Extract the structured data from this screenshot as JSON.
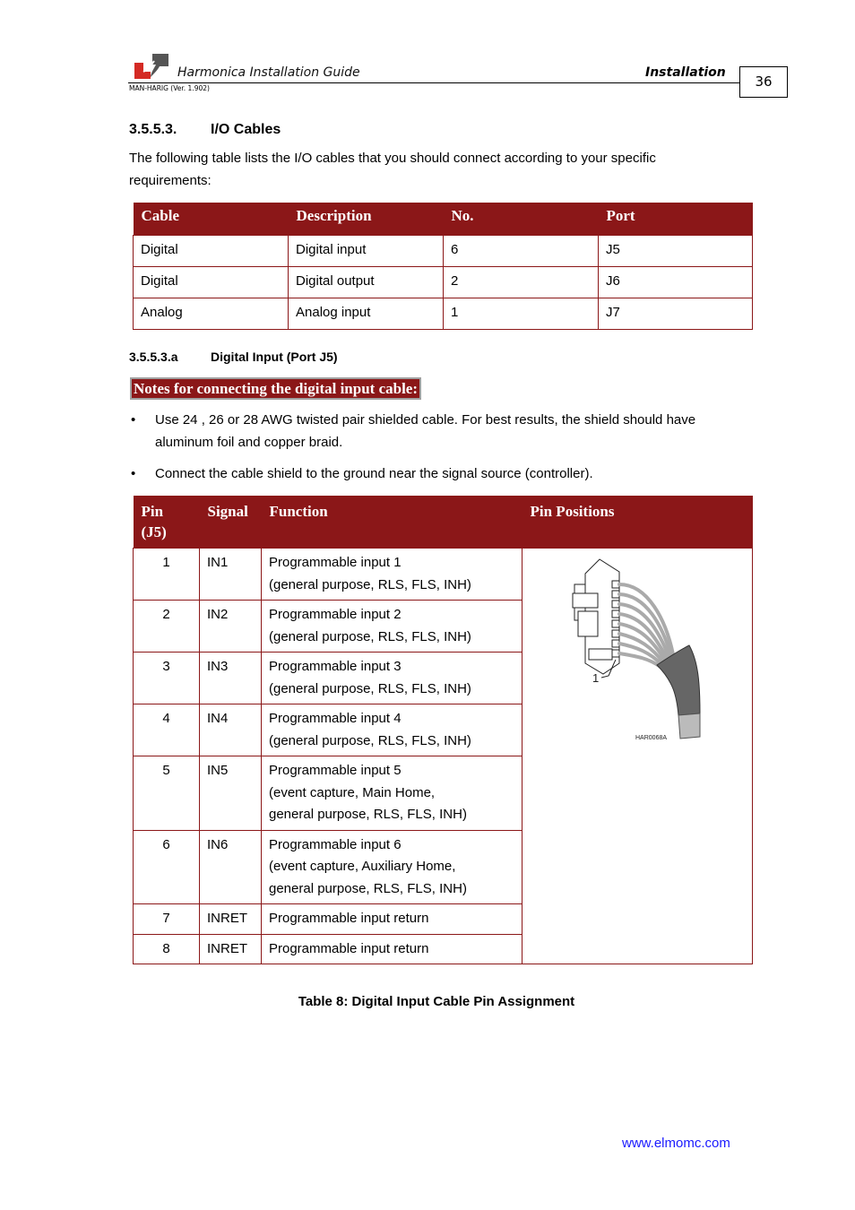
{
  "header": {
    "doc_title": "Harmonica Installation Guide",
    "section": "Installation",
    "version": "MAN-HARIG (Ver. 1.902)",
    "page_number": "36",
    "logo": "elmo-logo-icon"
  },
  "section_io": {
    "number": "3.5.5.3.",
    "title": "I/O Cables",
    "intro": "The following table lists the I/O cables that you should connect according to your specific requirements:"
  },
  "cable_table": {
    "headers": [
      "Cable",
      "Description",
      "No.",
      "Port"
    ],
    "rows": [
      [
        "Digital",
        "Digital input",
        "6",
        "J5"
      ],
      [
        "Digital",
        "Digital output",
        "2",
        "J6"
      ],
      [
        "Analog",
        "Analog input",
        "1",
        "J7"
      ]
    ]
  },
  "section_digital": {
    "number": "3.5.5.3.a",
    "title": "Digital Input (Port J5)",
    "notes_heading": "Notes for connecting the digital input cable:",
    "bullets": [
      "Use 24 , 26 or 28 AWG twisted pair shielded cable. For best results, the shield should have aluminum foil and copper braid.",
      "Connect the cable shield to the ground near the signal source (controller)."
    ],
    "bullet_char": "•"
  },
  "pin_table": {
    "headers": [
      "Pin (J5)",
      "Signal",
      "Function",
      "Pin Positions"
    ],
    "rows": [
      {
        "pin": "1",
        "signal": "IN1",
        "function": [
          "Programmable input 1",
          "(general purpose, RLS, FLS, INH)"
        ]
      },
      {
        "pin": "2",
        "signal": "IN2",
        "function": [
          "Programmable input 2",
          "(general purpose, RLS, FLS, INH)"
        ]
      },
      {
        "pin": "3",
        "signal": "IN3",
        "function": [
          "Programmable input 3",
          "(general purpose, RLS, FLS, INH)"
        ]
      },
      {
        "pin": "4",
        "signal": "IN4",
        "function": [
          "Programmable input 4",
          "(general purpose, RLS, FLS, INH)"
        ]
      },
      {
        "pin": "5",
        "signal": "IN5",
        "function": [
          "Programmable input 5",
          "(event capture, Main Home,",
          "general purpose, RLS, FLS, INH)"
        ]
      },
      {
        "pin": "6",
        "signal": "IN6",
        "function": [
          "Programmable input 6",
          "(event capture, Auxiliary Home,",
          "general purpose, RLS, FLS, INH)"
        ]
      },
      {
        "pin": "7",
        "signal": "INRET",
        "function": [
          "Programmable input return"
        ]
      },
      {
        "pin": "8",
        "signal": "INRET",
        "function": [
          "Programmable input return"
        ]
      }
    ],
    "figure": {
      "pin_label": "1",
      "figure_id": "HAR0068A"
    }
  },
  "caption": "Table 8: Digital Input Cable Pin Assignment",
  "footer": {
    "url": "www.elmomc.com"
  },
  "colors": {
    "table_header": "#8b1718",
    "link": "#1a1aff"
  }
}
